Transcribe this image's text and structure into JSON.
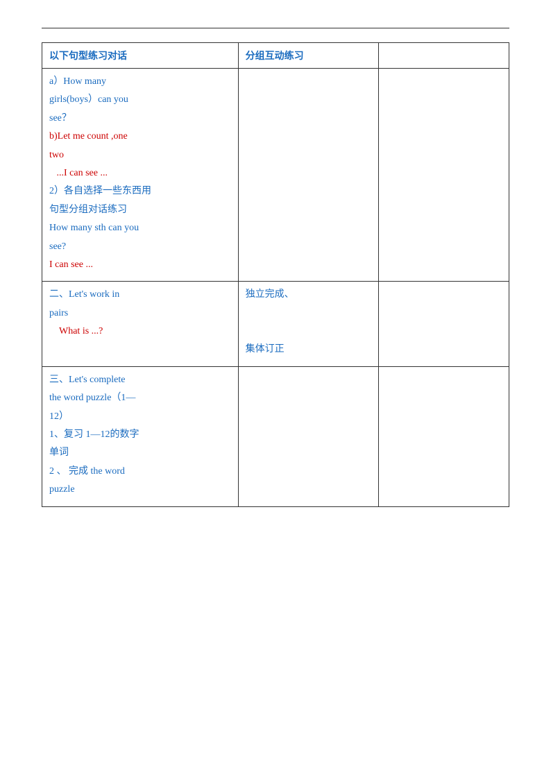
{
  "page": {
    "table": {
      "col1_header": "以下句型练习对话",
      "col2_header": "分组互动练习",
      "col3_header": "",
      "rows": [
        {
          "col1": [
            {
              "text": "a）How many",
              "color": "blue"
            },
            {
              "text": "girls(boys）can you",
              "color": "blue"
            },
            {
              "text": "see？",
              "color": "blue"
            },
            {
              "text": "b)Let me count ,one",
              "color": "red"
            },
            {
              "text": "two",
              "color": "red"
            },
            {
              "text": "   ...I can see ...",
              "color": "red"
            },
            {
              "text": "2）各自选择一些东西用",
              "color": "blue"
            },
            {
              "text": "句型分组对话练习",
              "color": "blue"
            },
            {
              "text": "How many sth can you",
              "color": "blue"
            },
            {
              "text": "see?",
              "color": "blue"
            },
            {
              "text": "I can see ...",
              "color": "red"
            }
          ],
          "col2": "",
          "col3": ""
        },
        {
          "col1": [
            {
              "text": "二、Let's work in",
              "color": "blue"
            },
            {
              "text": "pairs",
              "color": "blue"
            },
            {
              "text": "    What is ...?",
              "color": "red"
            }
          ],
          "col2": [
            {
              "text": "独立完成、",
              "color": "blue"
            },
            {
              "text": "",
              "color": ""
            },
            {
              "text": "集体订正",
              "color": "blue"
            }
          ],
          "col3": ""
        },
        {
          "col1": [
            {
              "text": "三、Let's complete",
              "color": "blue"
            },
            {
              "text": "the word puzzle（1—",
              "color": "blue"
            },
            {
              "text": "12）",
              "color": "blue"
            },
            {
              "text": "1、复习 1—12的数字",
              "color": "blue"
            },
            {
              "text": "单词",
              "color": "blue"
            },
            {
              "text": "2 、 完成 the word",
              "color": "blue"
            },
            {
              "text": "puzzle",
              "color": "blue"
            }
          ],
          "col2": "",
          "col3": ""
        }
      ]
    }
  }
}
